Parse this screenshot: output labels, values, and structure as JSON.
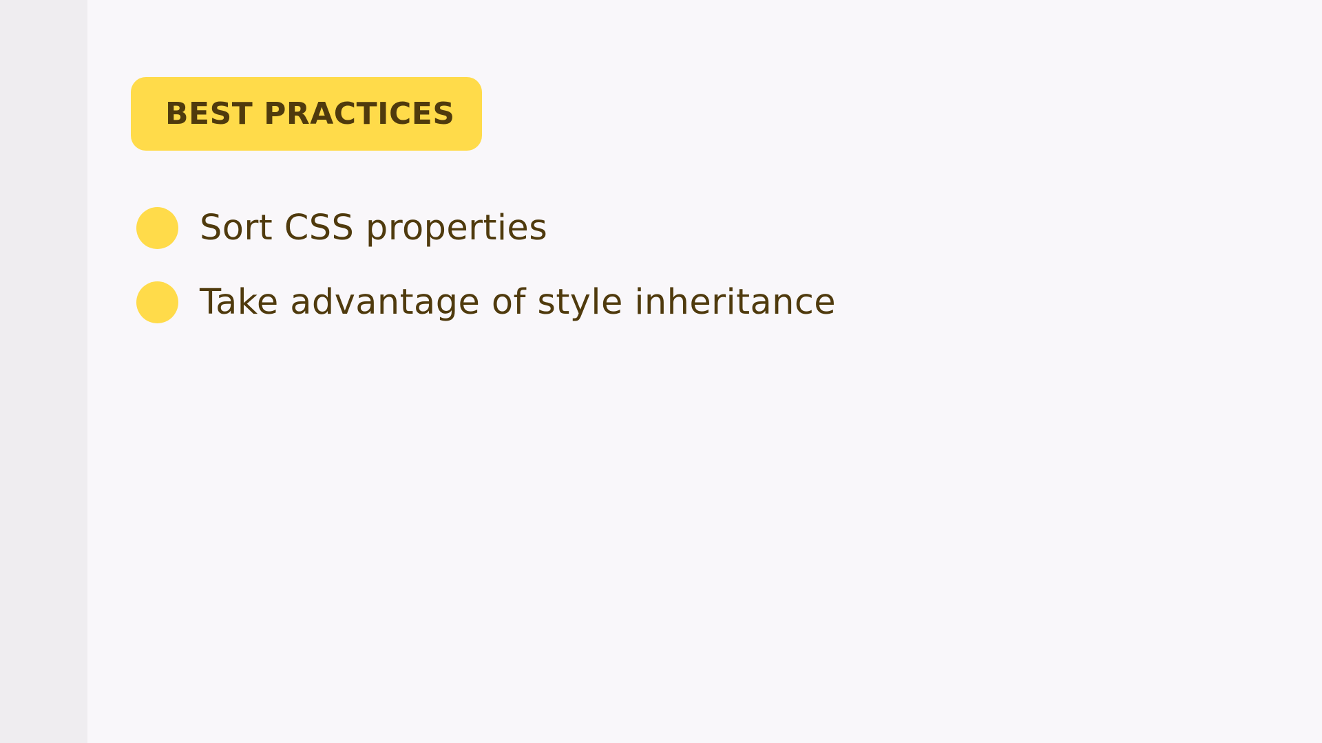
{
  "section": {
    "badge_label": "BEST PRACTICES",
    "items": [
      {
        "label": "Sort CSS properties"
      },
      {
        "label": "Take advantage of style inheritance"
      }
    ]
  },
  "colors": {
    "badge_background": "#ffdb4a",
    "text": "#4f3a0d",
    "page_background": "#f9f7fa",
    "rail_background": "#efedf0"
  },
  "icons": {
    "bullet": "bullet-icon"
  }
}
